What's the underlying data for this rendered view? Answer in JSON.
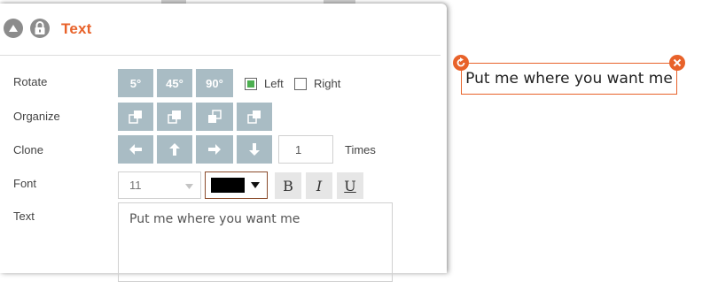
{
  "panel": {
    "title": "Text"
  },
  "rotate": {
    "label": "Rotate",
    "buttons": [
      "5°",
      "45°",
      "90°"
    ],
    "left_label": "Left",
    "left_checked": true,
    "right_label": "Right",
    "right_checked": false
  },
  "organize": {
    "label": "Organize",
    "buttons": [
      "bring-to-front-icon",
      "bring-forward-icon",
      "send-backward-icon",
      "send-to-back-icon"
    ]
  },
  "clone": {
    "label": "Clone",
    "buttons": [
      "arrow-left-icon",
      "arrow-up-icon",
      "arrow-right-icon",
      "arrow-down-icon"
    ],
    "count": "1",
    "times_label": "Times"
  },
  "font": {
    "label": "Font",
    "size": "11",
    "color": "#000000",
    "bold": "B",
    "italic": "I",
    "underline": "U"
  },
  "text": {
    "label": "Text",
    "value": "Put me where you want me"
  },
  "canvas": {
    "text": "Put me where you want me",
    "border_color": "#e8622a"
  },
  "colors": {
    "accent": "#e8622a",
    "button_bg": "#a9bcc4",
    "checkbox_green": "#4caf50"
  }
}
